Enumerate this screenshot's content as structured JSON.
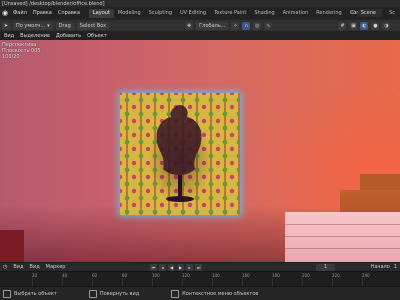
{
  "titlebar": {
    "path": "[Unsaved] /desktop/blender/office.blend]"
  },
  "menubar": {
    "menus": [
      "Файл",
      "Правка",
      "Справка"
    ],
    "tabs": [
      "Layout",
      "Modeling",
      "Sculpting",
      "UV Editing",
      "Texture Paint",
      "Shading",
      "Animation",
      "Rendering",
      "Compositing",
      "Sc"
    ],
    "active_tab": "Layout",
    "scene": "Scene"
  },
  "toolbar": {
    "orientation_label": "По умолч...",
    "drag_label": "Drag",
    "select_label": "Select Box",
    "pivot_label": "Глобаль..."
  },
  "viewport_header": {
    "items": [
      "Вид",
      "Выделение",
      "Добавить",
      "Объект"
    ]
  },
  "overlay": {
    "lines": [
      "Перспектива",
      "Плоскость 005",
      "100/20"
    ]
  },
  "timeline": {
    "items": [
      "Вид",
      "Вид",
      "Маркер"
    ],
    "frame": "1",
    "start_label": "Начало",
    "start": "1"
  },
  "ruler": {
    "ticks": [
      "20",
      "40",
      "60",
      "80",
      "100",
      "120",
      "140",
      "160",
      "180",
      "200",
      "220",
      "240"
    ]
  },
  "statusbar": {
    "select": "Выбрать объект",
    "rotate": "Повернуть вид",
    "context": "Контекстное меню объектов"
  },
  "colors": {
    "accent_tab": "#3d3d3d",
    "glow": "#50c8ff"
  },
  "icons": [
    "blender-logo-icon",
    "cursor-icon",
    "grid-icon",
    "magnet-icon",
    "camera-icon",
    "play-icon"
  ]
}
